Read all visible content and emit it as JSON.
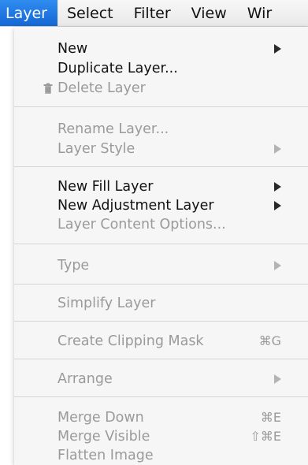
{
  "menubar": {
    "items": [
      "Layer",
      "Select",
      "Filter",
      "View",
      "Wir"
    ]
  },
  "menu": {
    "new": "New",
    "duplicate_layer": "Duplicate Layer...",
    "delete_layer": "Delete Layer",
    "rename_layer": "Rename Layer...",
    "layer_style": "Layer Style",
    "new_fill_layer": "New Fill Layer",
    "new_adjustment_layer": "New Adjustment Layer",
    "layer_content_options": "Layer Content Options...",
    "type": "Type",
    "simplify_layer": "Simplify Layer",
    "create_clipping_mask": "Create Clipping Mask",
    "create_clipping_mask_shortcut": "⌘G",
    "arrange": "Arrange",
    "merge_down": "Merge Down",
    "merge_down_shortcut": "⌘E",
    "merge_visible": "Merge Visible",
    "merge_visible_shortcut": "⇧⌘E",
    "flatten_image": "Flatten Image"
  },
  "colors": {
    "highlight": "#1f74e0",
    "enabled_text": "#111111",
    "disabled_text": "#9a9a9a"
  },
  "icons": {
    "delete_layer": "trash-icon",
    "submenu": "submenu-arrow-icon"
  }
}
